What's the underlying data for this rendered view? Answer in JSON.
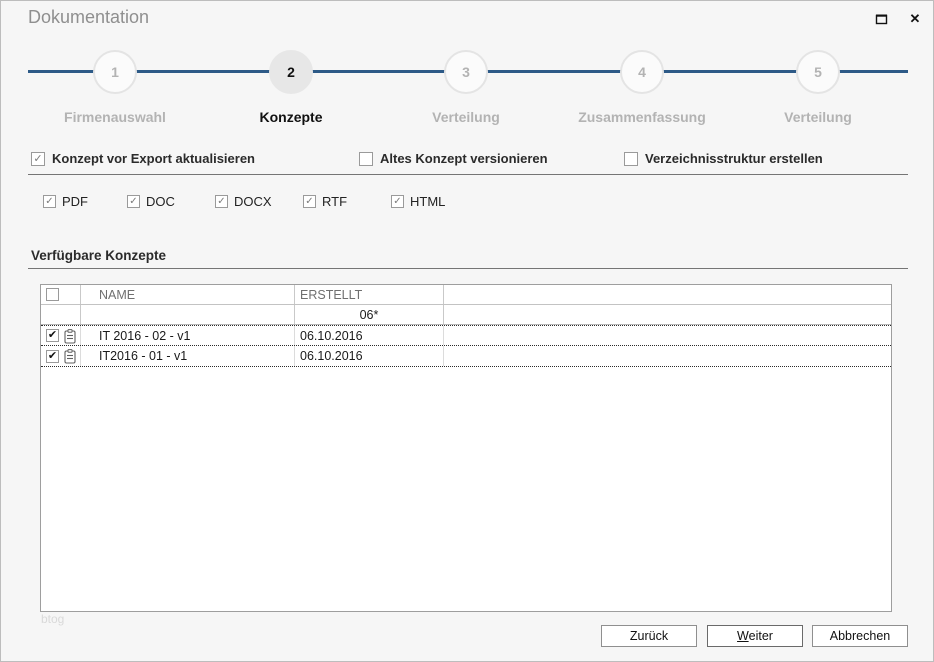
{
  "window": {
    "title": "Dokumentation",
    "close_glyph": "✕"
  },
  "stepper": {
    "steps": [
      {
        "number": "1",
        "label": "Firmenauswahl",
        "active": false
      },
      {
        "number": "2",
        "label": "Konzepte",
        "active": true
      },
      {
        "number": "3",
        "label": "Verteilung",
        "active": false
      },
      {
        "number": "4",
        "label": "Zusammenfassung",
        "active": false
      },
      {
        "number": "5",
        "label": "Verteilung",
        "active": false
      }
    ]
  },
  "options": [
    {
      "label": "Konzept vor Export aktualisieren",
      "checked": true,
      "glyph": "✓"
    },
    {
      "label": "Altes Konzept versionieren",
      "checked": false,
      "glyph": ""
    },
    {
      "label": "Verzeichnisstruktur erstellen",
      "checked": false,
      "glyph": ""
    }
  ],
  "formats": [
    {
      "label": "PDF",
      "checked": true,
      "glyph": "✓"
    },
    {
      "label": "DOC",
      "checked": true,
      "glyph": "✓"
    },
    {
      "label": "DOCX",
      "checked": true,
      "glyph": "✓"
    },
    {
      "label": "RTF",
      "checked": true,
      "glyph": "✓"
    },
    {
      "label": "HTML",
      "checked": true,
      "glyph": "✓"
    }
  ],
  "concepts_section": {
    "heading": "Verfügbare Konzepte"
  },
  "table": {
    "header": {
      "name": "NAME",
      "erstellt": "ERSTELLT"
    },
    "filter": {
      "erstellt": "06*"
    },
    "rows": [
      {
        "checked": true,
        "glyph": "✔",
        "name": "IT 2016 - 02 - v1",
        "erstellt": "06.10.2016"
      },
      {
        "checked": true,
        "glyph": "✔",
        "name": "IT2016 - 01 - v1",
        "erstellt": "06.10.2016"
      }
    ]
  },
  "watermark": "btog",
  "footer": {
    "back_label": "Zurück",
    "next_prefix": "W",
    "next_rest": "eiter",
    "cancel_label": "Abbrechen"
  },
  "colors": {
    "accent_blue": "#2d5a87",
    "active_step_bg": "#e7e7e7",
    "inactive_text": "#b3b3b3"
  }
}
